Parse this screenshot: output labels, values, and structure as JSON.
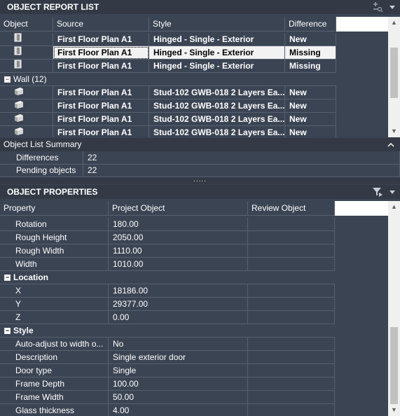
{
  "report_panel": {
    "title": "OBJECT REPORT LIST",
    "columns": [
      "Object",
      "Source",
      "Style",
      "Difference"
    ],
    "door_rows": [
      {
        "source": "First Floor Plan A1",
        "style": "Hinged - Single - Exterior",
        "difference": "New"
      },
      {
        "source": "First Floor Plan A1",
        "style": "Hinged - Single - Exterior",
        "difference": "Missing"
      },
      {
        "source": "First Floor Plan A1",
        "style": "Hinged - Single - Exterior",
        "difference": "Missing"
      }
    ],
    "wall_group": {
      "label": "Wall (12)",
      "toggle": "−"
    },
    "wall_rows": [
      {
        "source": "First Floor Plan A1",
        "style": "Stud-102 GWB-018 2 Layers Ea...",
        "difference": "New"
      },
      {
        "source": "First Floor Plan A1",
        "style": "Stud-102 GWB-018 2 Layers Ea...",
        "difference": "New"
      },
      {
        "source": "First Floor Plan A1",
        "style": "Stud-102 GWB-018 2 Layers Ea...",
        "difference": "New"
      },
      {
        "source": "First Floor Plan A1",
        "style": "Stud-102 GWB-018 2 Layers Ea...",
        "difference": "New"
      }
    ]
  },
  "summary": {
    "title": "Object List Summary",
    "rows": [
      {
        "label": "Differences",
        "value": "22"
      },
      {
        "label": "Pending objects",
        "value": "22"
      }
    ]
  },
  "splitter_grip": ".....",
  "properties_panel": {
    "title": "OBJECT PROPERTIES",
    "columns": [
      "Property",
      "Project Object",
      "Review Object"
    ],
    "dimensions": [
      {
        "name": "Rotation",
        "value": "180.00"
      },
      {
        "name": "Rough Height",
        "value": "2050.00"
      },
      {
        "name": "Rough Width",
        "value": "1110.00"
      },
      {
        "name": "Width",
        "value": "1010.00"
      }
    ],
    "location_label": "Location",
    "location": [
      {
        "name": "X",
        "value": "18186.00"
      },
      {
        "name": "Y",
        "value": "29377.00"
      },
      {
        "name": "Z",
        "value": "0.00"
      }
    ],
    "style_label": "Style",
    "style": [
      {
        "name": "Auto-adjust to width o...",
        "value": "No"
      },
      {
        "name": "Description",
        "value": "Single exterior door"
      },
      {
        "name": "Door type",
        "value": "Single"
      },
      {
        "name": "Frame Depth",
        "value": "100.00"
      },
      {
        "name": "Frame Width",
        "value": "50.00"
      },
      {
        "name": "Glass thickness",
        "value": "4.00"
      }
    ],
    "category_toggle": "−"
  },
  "icons": {
    "door": "door-icon",
    "wall": "wall-icon",
    "highlight": "highlight-icon",
    "filter": "filter-icon",
    "menu": "menu-caret-icon",
    "collapse": "collapse-icon"
  },
  "colors": {
    "panel_bg": "#3b4453",
    "header_bg": "#333a45",
    "grid_line": "#56606f",
    "selection_bg": "#f2f2f2"
  }
}
